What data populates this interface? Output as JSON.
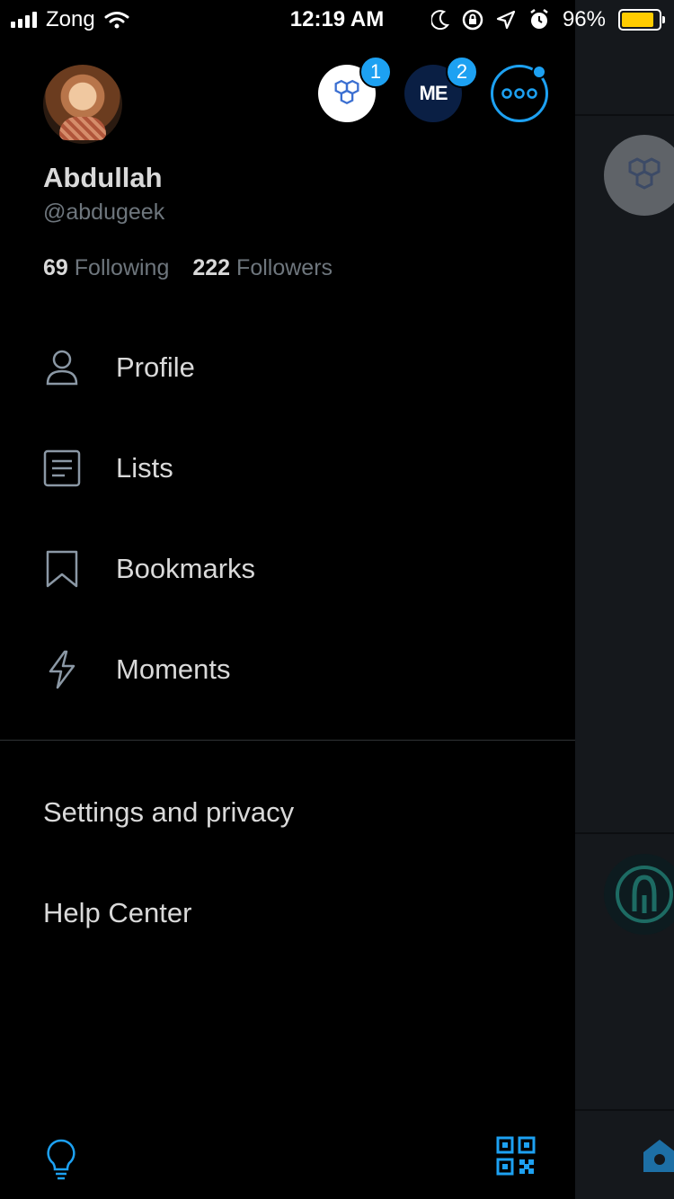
{
  "status_bar": {
    "carrier": "Zong",
    "time": "12:19 AM",
    "battery_percent": "96%",
    "battery_level": 0.96,
    "battery_color": "#ffcc00"
  },
  "profile": {
    "name": "Abdullah",
    "handle": "@abdugeek",
    "following_count": "69",
    "following_label": "Following",
    "followers_count": "222",
    "followers_label": "Followers"
  },
  "accounts": [
    {
      "icon": "hexagon-logo-icon",
      "badge": "1"
    },
    {
      "icon": "me-logo-icon",
      "text": "ME",
      "badge": "2"
    },
    {
      "icon": "more-accounts-icon"
    }
  ],
  "menu": [
    {
      "label": "Profile",
      "icon": "person-icon"
    },
    {
      "label": "Lists",
      "icon": "list-icon"
    },
    {
      "label": "Bookmarks",
      "icon": "bookmark-icon"
    },
    {
      "label": "Moments",
      "icon": "lightning-icon"
    }
  ],
  "secondary_menu": [
    {
      "label": "Settings and privacy"
    },
    {
      "label": "Help Center"
    }
  ],
  "bottom": {
    "left_icon": "lightbulb-icon",
    "right_icon": "qr-code-icon"
  },
  "colors": {
    "accent": "#1da1f2",
    "text_primary": "#d9d9d9",
    "text_secondary": "#6e767d",
    "background": "#000000"
  }
}
